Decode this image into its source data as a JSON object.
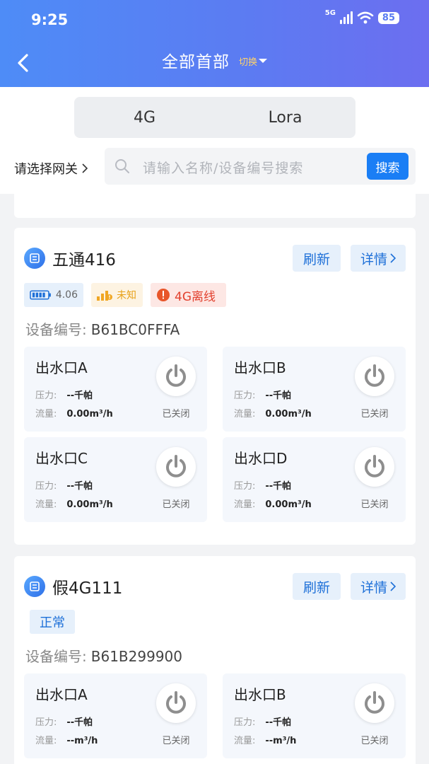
{
  "status_bar": {
    "time": "9:25",
    "network": "5G",
    "battery": "85"
  },
  "header": {
    "title": "全部首部",
    "switch_label": "切换"
  },
  "tabs": [
    {
      "label": "4G"
    },
    {
      "label": "Lora"
    }
  ],
  "gateway": {
    "label": "请选择网关"
  },
  "search": {
    "placeholder": "请输入名称/设备编号搜索",
    "button": "搜索"
  },
  "devices": [
    {
      "name": "五通416",
      "refresh_label": "刷新",
      "detail_label": "详情",
      "battery_voltage": "4.06",
      "signal_text": "未知",
      "status_text": "4G离线",
      "serial_label": "设备编号:",
      "serial": "B61BC0FFFA",
      "outlets": [
        {
          "name": "出水口A",
          "pressure_label": "压力:",
          "pressure": "--千帕",
          "flow_label": "流量:",
          "flow": "0.00m³/h",
          "state": "已关闭"
        },
        {
          "name": "出水口B",
          "pressure_label": "压力:",
          "pressure": "--千帕",
          "flow_label": "流量:",
          "flow": "0.00m³/h",
          "state": "已关闭"
        },
        {
          "name": "出水口C",
          "pressure_label": "压力:",
          "pressure": "--千帕",
          "flow_label": "流量:",
          "flow": "0.00m³/h",
          "state": "已关闭"
        },
        {
          "name": "出水口D",
          "pressure_label": "压力:",
          "pressure": "--千帕",
          "flow_label": "流量:",
          "flow": "0.00m³/h",
          "state": "已关闭"
        }
      ]
    },
    {
      "name": "假4G111",
      "refresh_label": "刷新",
      "detail_label": "详情",
      "status_text": "正常",
      "serial_label": "设备编号:",
      "serial": "B61B299900",
      "outlets": [
        {
          "name": "出水口A",
          "pressure_label": "压力:",
          "pressure": "--千帕",
          "flow_label": "流量:",
          "flow": "--m³/h",
          "state": "已关闭"
        },
        {
          "name": "出水口B",
          "pressure_label": "压力:",
          "pressure": "--千帕",
          "flow_label": "流量:",
          "flow": "--m³/h",
          "state": "已关闭"
        }
      ]
    }
  ],
  "colors": {
    "header_start": "#4e8cf7",
    "header_end": "#6c6ef0",
    "accent": "#1a7ef5",
    "offline": "#e2412e",
    "signal": "#e8a21a"
  }
}
